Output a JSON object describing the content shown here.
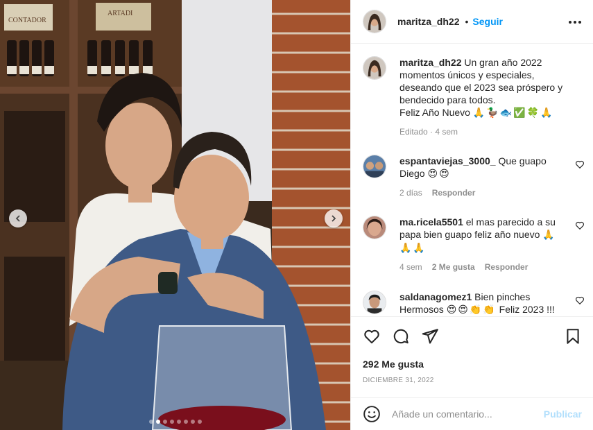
{
  "post": {
    "author": {
      "username": "maritza_dh22",
      "separator": "•",
      "follow_label": "Seguir"
    },
    "photo": {
      "wine_labels": [
        "CONTADOR",
        "ARTADI"
      ],
      "carousel_dots": 8,
      "active_dot": 1
    },
    "caption": {
      "username": "maritza_dh22",
      "text": "Un gran año 2022 momentos únicos y especiales, deseando que el 2023 sea próspero y bendecido para todos.",
      "line2": "Feliz Año Nuevo",
      "emojis": "🙏🦆🐟✅🍀🙏",
      "edited": "Editado · 4 sem"
    },
    "comments": [
      {
        "username": "espantaviejas_3000_",
        "text": "Que guapo Diego",
        "emojis": "😍😍",
        "time": "2 días",
        "likes": "",
        "reply": "Responder",
        "avatar_color": "#5b7fa8"
      },
      {
        "username": "ma.ricela5501",
        "text": "el mas parecido a su papa bien guapo feliz año nuevo",
        "emojis": "🙏🙏🙏",
        "time": "4 sem",
        "likes": "2 Me gusta",
        "reply": "Responder",
        "avatar_color": "#a06a5a"
      },
      {
        "username": "saldanagomez1",
        "text": "Bien pinches Hermosos",
        "emojis": "😍😍👏👏",
        "tail": "Feliz 2023 !!!",
        "time": "",
        "likes": "",
        "reply": "",
        "avatar_color": "#4a4a4a"
      }
    ],
    "likes_label": "292 Me gusta",
    "date": "DICIEMBRE 31, 2022",
    "add_comment": {
      "placeholder": "Añade un comentario...",
      "publish": "Publicar"
    },
    "colors": {
      "accent": "#0095f6",
      "publish_disabled": "#b2dffc",
      "muted": "#8e8e8e",
      "text": "#262626"
    }
  }
}
